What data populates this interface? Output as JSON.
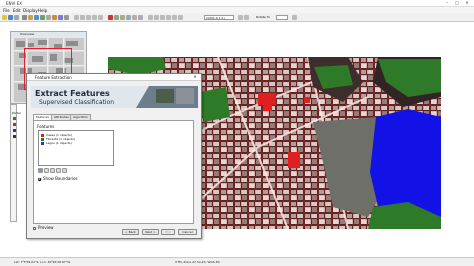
{
  "window": {
    "title": "ENVI EX",
    "controls": [
      "–",
      "□",
      "✕"
    ]
  },
  "menu": [
    "File",
    "Edit",
    "Display",
    "Help"
  ],
  "toolbar": {
    "zoom_value": "1(001.0 1:1)",
    "rotate_label": "Rotate To"
  },
  "overview": {
    "title": "Overview"
  },
  "layers": {
    "label": "Portal",
    "swatches": [
      "#2f7d2f",
      "#cf2222",
      "#2230c7",
      "#3a2a55"
    ]
  },
  "dialog": {
    "title": "Feature Extraction",
    "banner_title": "Extract Features",
    "banner_subtitle": "Supervised Classification",
    "tabs": [
      "Features",
      "Attributes",
      "Algorithm"
    ],
    "features_label": "Features",
    "features": [
      {
        "label": "Casas (1 objects)",
        "color": "#d51f1f"
      },
      {
        "label": "Floresta (1 objects)",
        "color": "#1c7a23"
      },
      {
        "label": "Lagos (1 objects)",
        "color": "#1f3dd6"
      }
    ],
    "show_boundaries_label": "Show Boundaries",
    "show_boundaries_checked": true,
    "preview_label": "Preview",
    "preview_checked": false,
    "buttons": {
      "back": "< Back",
      "next": "Next >",
      "finish": "Fini",
      "cancel": "Cancel"
    }
  },
  "status": {
    "coords": "Lat: 7²5'59.01\"S, Lon: 40²26'26.67\"W",
    "projection": "UTM, Zone 22 South, WGS-84"
  },
  "colors": {
    "forest": "#2e7a28",
    "lake": "#1212e6",
    "houses": "#e02020",
    "boundary": "#c91818"
  }
}
